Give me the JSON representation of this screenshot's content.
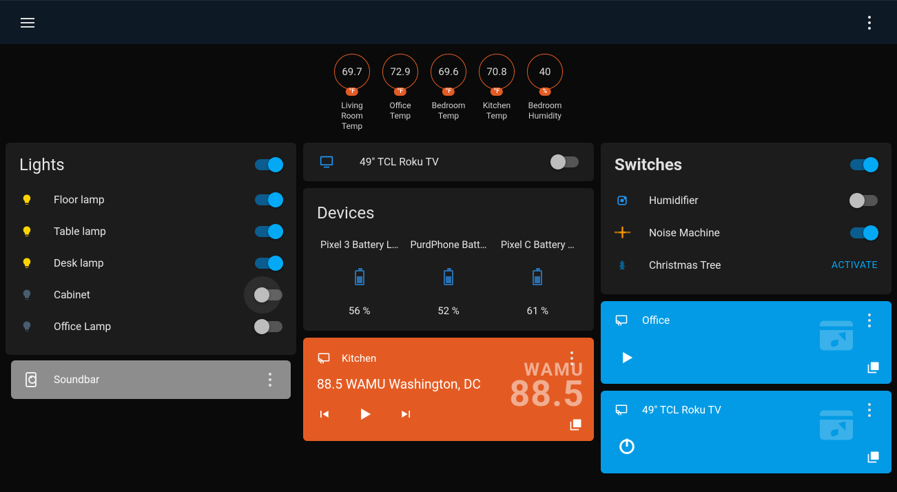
{
  "sensors": [
    {
      "value": "69.7",
      "unit": "°F",
      "label": "Living Room Temp"
    },
    {
      "value": "72.9",
      "unit": "°F",
      "label": "Office Temp"
    },
    {
      "value": "69.6",
      "unit": "°F",
      "label": "Bedroom Temp"
    },
    {
      "value": "70.8",
      "unit": "°F",
      "label": "Kitchen Temp"
    },
    {
      "value": "40",
      "unit": "%",
      "label": "Bedroom Humidity"
    }
  ],
  "lights": {
    "title": "Lights",
    "master_on": true,
    "items": [
      {
        "name": "Floor lamp",
        "on": true
      },
      {
        "name": "Table lamp",
        "on": true
      },
      {
        "name": "Desk lamp",
        "on": true
      },
      {
        "name": "Cabinet",
        "on": false
      },
      {
        "name": "Office Lamp",
        "on": false
      }
    ]
  },
  "soundbar": {
    "name": "Soundbar"
  },
  "tv_switch": {
    "name": "49\" TCL Roku TV",
    "on": false
  },
  "devices": {
    "title": "Devices",
    "items": [
      {
        "name": "Pixel 3 Battery L…",
        "value": "56 %"
      },
      {
        "name": "PurdPhone Batt…",
        "value": "52 %"
      },
      {
        "name": "Pixel C Battery …",
        "value": "61 %"
      }
    ]
  },
  "media_kitchen": {
    "room": "Kitchen",
    "title": "88.5 WAMU Washington, DC",
    "bg_l1": "WAMU",
    "bg_l2": "88.5"
  },
  "switches": {
    "title": "Switches",
    "master_on": true,
    "items": [
      {
        "name": "Humidifier",
        "kind": "toggle",
        "on": false,
        "icon": "humidifier"
      },
      {
        "name": "Noise Machine",
        "kind": "toggle",
        "on": true,
        "icon": "wave"
      },
      {
        "name": "Christmas Tree",
        "kind": "action",
        "action": "ACTIVATE",
        "icon": "tree"
      }
    ]
  },
  "media_office": {
    "room": "Office"
  },
  "media_tv": {
    "room": "49\" TCL Roku TV"
  }
}
